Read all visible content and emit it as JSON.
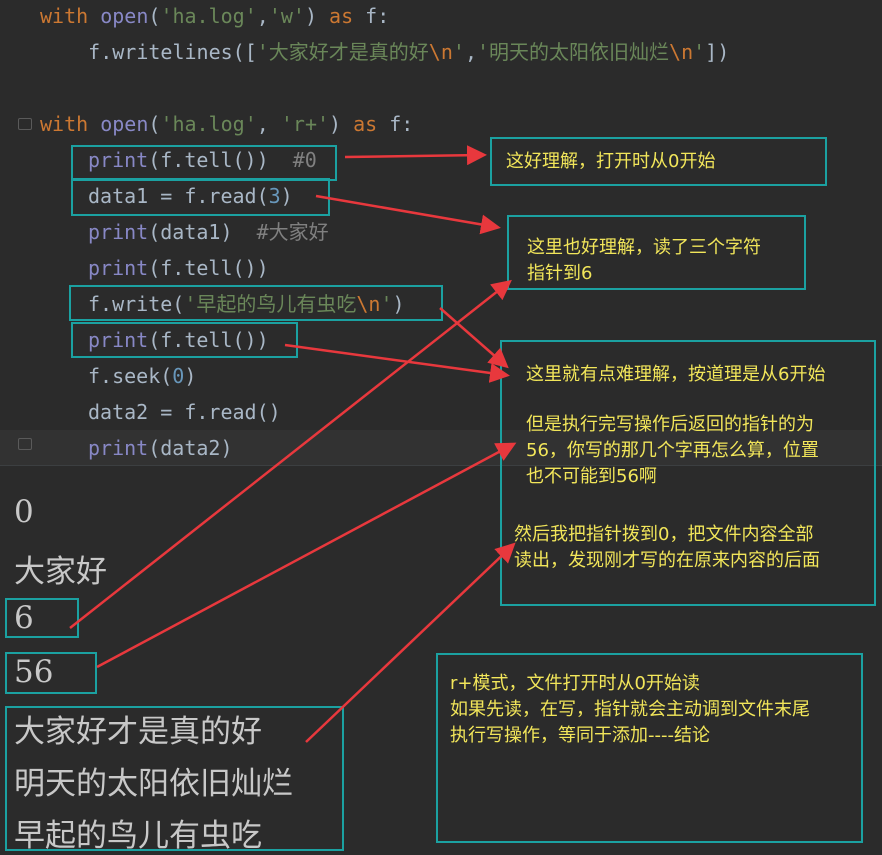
{
  "code": {
    "line1": {
      "kw_with": "with",
      "fn_open": "open",
      "p1": "(",
      "s1": "'ha.log'",
      "c1": ",",
      "s2": "'w'",
      "p2": ") ",
      "kw_as": "as",
      "rest": " f:"
    },
    "line2": {
      "pre": "    f.writelines([",
      "s1": "'大家好才是真的好",
      "e1": "\\n",
      "q1": "'",
      "c1": ",",
      "s2": "'明天的太阳依旧灿烂",
      "e2": "\\n",
      "q2": "'",
      "post": "])"
    },
    "line4": {
      "kw_with": "with",
      "fn_open": "open",
      "p1": "(",
      "s1": "'ha.log'",
      "c1": ", ",
      "s2": "'r+'",
      "p2": ") ",
      "kw_as": "as",
      "rest": " f:"
    },
    "line5": {
      "fn": "print",
      "body": "(f.tell())  ",
      "comment": "#0"
    },
    "line6": {
      "pre": "data1 = f.read(",
      "num": "3",
      "post": ")"
    },
    "line7": {
      "fn": "print",
      "body": "(data1)  ",
      "comment": "#大家好"
    },
    "line8": {
      "fn": "print",
      "body": "(f.tell())"
    },
    "line9": {
      "pre": "f.write(",
      "s1": "'早起的鸟儿有虫吃",
      "e1": "\\n",
      "q1": "'",
      "post": ")"
    },
    "line10": {
      "fn": "print",
      "body": "(f.tell())"
    },
    "line11": {
      "pre": "f.seek(",
      "num": "0",
      "post": ")"
    },
    "line12": {
      "text": "data2 = f.read()"
    },
    "line13": {
      "fn": "print",
      "body": "(data2)"
    }
  },
  "console": {
    "out1": "0",
    "out2": "大家好",
    "out3": "6",
    "out4": "56",
    "out5": "大家好才是真的好",
    "out6": "明天的太阳依旧灿烂",
    "out7": "早起的鸟儿有虫吃"
  },
  "notes": {
    "note1": "这好理解，打开时从0开始",
    "note2_l1": "这里也好理解，读了三个字符",
    "note2_l2": "指针到6",
    "note3_l1": "这里就有点难理解，按道理是从6开始",
    "note3_l2": "但是执行完写操作后返回的指针的为",
    "note3_l3": "56，你写的那几个字再怎么算，位置",
    "note3_l4": "也不可能到56啊",
    "note3_l5": "然后我把指针拨到0，把文件内容全部",
    "note3_l6": "读出，发现刚才写的在原来内容的后面",
    "note4_l1": "r+模式，文件打开时从0开始读",
    "note4_l2": "如果先读，在写，指针就会主动调到文件末尾",
    "note4_l3": "执行写操作，等同于添加----结论"
  },
  "colors": {
    "annotation_box": "#1ba1a1",
    "annotation_text": "#f2e65a",
    "arrow": "#e8383d",
    "background": "#2b2b2b"
  }
}
